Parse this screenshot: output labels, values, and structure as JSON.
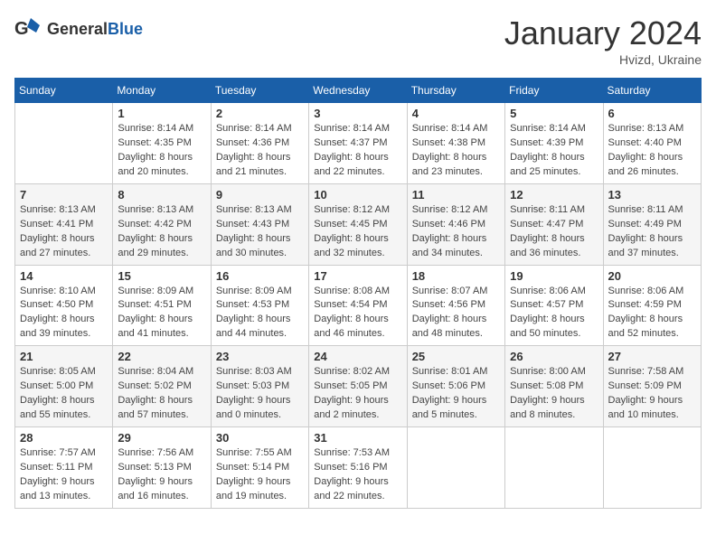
{
  "header": {
    "logo_general": "General",
    "logo_blue": "Blue",
    "month_title": "January 2024",
    "subtitle": "Hvizd, Ukraine"
  },
  "days_of_week": [
    "Sunday",
    "Monday",
    "Tuesday",
    "Wednesday",
    "Thursday",
    "Friday",
    "Saturday"
  ],
  "weeks": [
    [
      {
        "day": "",
        "info": ""
      },
      {
        "day": "1",
        "info": "Sunrise: 8:14 AM\nSunset: 4:35 PM\nDaylight: 8 hours\nand 20 minutes."
      },
      {
        "day": "2",
        "info": "Sunrise: 8:14 AM\nSunset: 4:36 PM\nDaylight: 8 hours\nand 21 minutes."
      },
      {
        "day": "3",
        "info": "Sunrise: 8:14 AM\nSunset: 4:37 PM\nDaylight: 8 hours\nand 22 minutes."
      },
      {
        "day": "4",
        "info": "Sunrise: 8:14 AM\nSunset: 4:38 PM\nDaylight: 8 hours\nand 23 minutes."
      },
      {
        "day": "5",
        "info": "Sunrise: 8:14 AM\nSunset: 4:39 PM\nDaylight: 8 hours\nand 25 minutes."
      },
      {
        "day": "6",
        "info": "Sunrise: 8:13 AM\nSunset: 4:40 PM\nDaylight: 8 hours\nand 26 minutes."
      }
    ],
    [
      {
        "day": "7",
        "info": "Sunrise: 8:13 AM\nSunset: 4:41 PM\nDaylight: 8 hours\nand 27 minutes."
      },
      {
        "day": "8",
        "info": "Sunrise: 8:13 AM\nSunset: 4:42 PM\nDaylight: 8 hours\nand 29 minutes."
      },
      {
        "day": "9",
        "info": "Sunrise: 8:13 AM\nSunset: 4:43 PM\nDaylight: 8 hours\nand 30 minutes."
      },
      {
        "day": "10",
        "info": "Sunrise: 8:12 AM\nSunset: 4:45 PM\nDaylight: 8 hours\nand 32 minutes."
      },
      {
        "day": "11",
        "info": "Sunrise: 8:12 AM\nSunset: 4:46 PM\nDaylight: 8 hours\nand 34 minutes."
      },
      {
        "day": "12",
        "info": "Sunrise: 8:11 AM\nSunset: 4:47 PM\nDaylight: 8 hours\nand 36 minutes."
      },
      {
        "day": "13",
        "info": "Sunrise: 8:11 AM\nSunset: 4:49 PM\nDaylight: 8 hours\nand 37 minutes."
      }
    ],
    [
      {
        "day": "14",
        "info": "Sunrise: 8:10 AM\nSunset: 4:50 PM\nDaylight: 8 hours\nand 39 minutes."
      },
      {
        "day": "15",
        "info": "Sunrise: 8:09 AM\nSunset: 4:51 PM\nDaylight: 8 hours\nand 41 minutes."
      },
      {
        "day": "16",
        "info": "Sunrise: 8:09 AM\nSunset: 4:53 PM\nDaylight: 8 hours\nand 44 minutes."
      },
      {
        "day": "17",
        "info": "Sunrise: 8:08 AM\nSunset: 4:54 PM\nDaylight: 8 hours\nand 46 minutes."
      },
      {
        "day": "18",
        "info": "Sunrise: 8:07 AM\nSunset: 4:56 PM\nDaylight: 8 hours\nand 48 minutes."
      },
      {
        "day": "19",
        "info": "Sunrise: 8:06 AM\nSunset: 4:57 PM\nDaylight: 8 hours\nand 50 minutes."
      },
      {
        "day": "20",
        "info": "Sunrise: 8:06 AM\nSunset: 4:59 PM\nDaylight: 8 hours\nand 52 minutes."
      }
    ],
    [
      {
        "day": "21",
        "info": "Sunrise: 8:05 AM\nSunset: 5:00 PM\nDaylight: 8 hours\nand 55 minutes."
      },
      {
        "day": "22",
        "info": "Sunrise: 8:04 AM\nSunset: 5:02 PM\nDaylight: 8 hours\nand 57 minutes."
      },
      {
        "day": "23",
        "info": "Sunrise: 8:03 AM\nSunset: 5:03 PM\nDaylight: 9 hours\nand 0 minutes."
      },
      {
        "day": "24",
        "info": "Sunrise: 8:02 AM\nSunset: 5:05 PM\nDaylight: 9 hours\nand 2 minutes."
      },
      {
        "day": "25",
        "info": "Sunrise: 8:01 AM\nSunset: 5:06 PM\nDaylight: 9 hours\nand 5 minutes."
      },
      {
        "day": "26",
        "info": "Sunrise: 8:00 AM\nSunset: 5:08 PM\nDaylight: 9 hours\nand 8 minutes."
      },
      {
        "day": "27",
        "info": "Sunrise: 7:58 AM\nSunset: 5:09 PM\nDaylight: 9 hours\nand 10 minutes."
      }
    ],
    [
      {
        "day": "28",
        "info": "Sunrise: 7:57 AM\nSunset: 5:11 PM\nDaylight: 9 hours\nand 13 minutes."
      },
      {
        "day": "29",
        "info": "Sunrise: 7:56 AM\nSunset: 5:13 PM\nDaylight: 9 hours\nand 16 minutes."
      },
      {
        "day": "30",
        "info": "Sunrise: 7:55 AM\nSunset: 5:14 PM\nDaylight: 9 hours\nand 19 minutes."
      },
      {
        "day": "31",
        "info": "Sunrise: 7:53 AM\nSunset: 5:16 PM\nDaylight: 9 hours\nand 22 minutes."
      },
      {
        "day": "",
        "info": ""
      },
      {
        "day": "",
        "info": ""
      },
      {
        "day": "",
        "info": ""
      }
    ]
  ]
}
